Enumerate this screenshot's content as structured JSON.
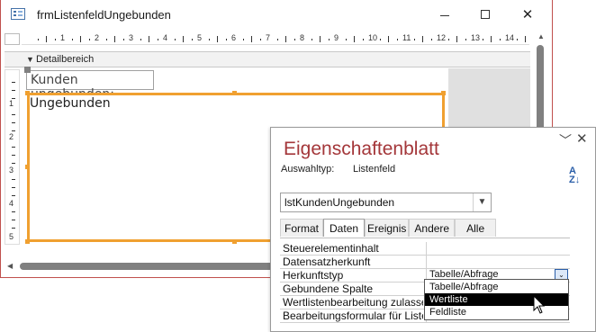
{
  "window": {
    "title": "frmListenfeldUngebunden",
    "minimize_icon": "minimize-icon",
    "maximize_icon": "maximize-icon",
    "close_symbol": "✕"
  },
  "ruler": {
    "h_numbers": [
      "1",
      "2",
      "3",
      "4",
      "5",
      "6",
      "7",
      "8",
      "9",
      "10",
      "11",
      "12",
      "13",
      "14"
    ],
    "v_numbers": [
      "1",
      "2",
      "3",
      "4",
      "5"
    ]
  },
  "section": {
    "label": "Detailbereich",
    "arrow": "🠇"
  },
  "controls": {
    "label_text": "Kunden ungebunden:",
    "listbox_text": "Ungebunden"
  },
  "property_sheet": {
    "title": "Eigenschaftenblatt",
    "selection_type_label": "Auswahltyp:",
    "selection_type_value": "Listenfeld",
    "sort_icon": "sort-az-icon",
    "control_name": "lstKundenUngebunden",
    "tabs": [
      {
        "label": "Format",
        "active": false
      },
      {
        "label": "Daten",
        "active": true
      },
      {
        "label": "Ereignis",
        "active": false
      },
      {
        "label": "Andere",
        "active": false
      },
      {
        "label": "Alle",
        "active": false
      }
    ],
    "rows": [
      {
        "name": "Steuerelementinhalt",
        "value": ""
      },
      {
        "name": "Datensatzherkunft",
        "value": ""
      },
      {
        "name": "Herkunftstyp",
        "value": "Tabelle/Abfrage"
      },
      {
        "name": "Gebundene Spalte",
        "value": ""
      },
      {
        "name": "Wertlistenbearbeitung zulassen",
        "value": ""
      },
      {
        "name": "Bearbeitungsformular für Listenelemente",
        "value": ""
      }
    ],
    "dropdown_options": [
      {
        "label": "Tabelle/Abfrage",
        "selected": false
      },
      {
        "label": "Wertliste",
        "selected": true
      },
      {
        "label": "Feldliste",
        "selected": false
      }
    ]
  }
}
